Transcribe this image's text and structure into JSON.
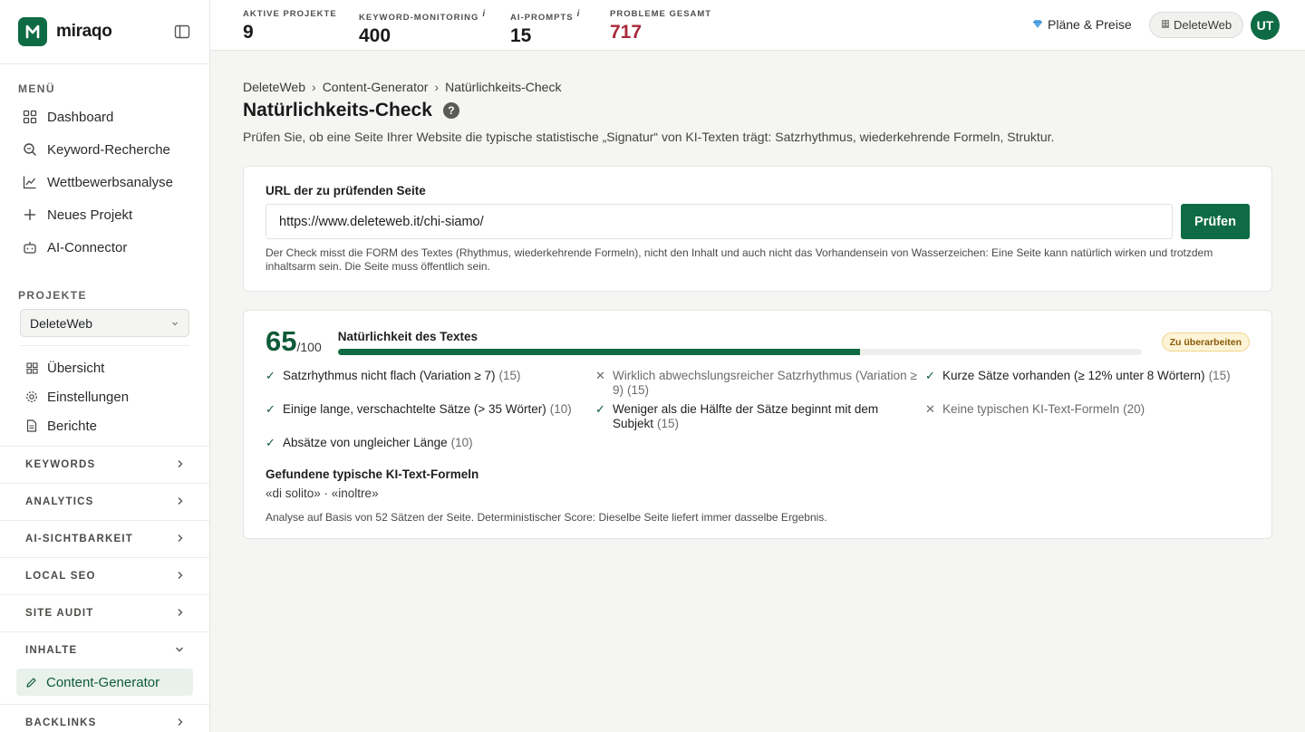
{
  "brand": {
    "name": "miraqo"
  },
  "sidebar": {
    "menu_label": "MENÜ",
    "menu_items": [
      {
        "label": "Dashboard",
        "icon": "grid-icon"
      },
      {
        "label": "Keyword-Recherche",
        "icon": "search-icon"
      },
      {
        "label": "Wettbewerbsanalyse",
        "icon": "chart-icon"
      },
      {
        "label": "Neues Projekt",
        "icon": "plus-icon"
      },
      {
        "label": "AI-Connector",
        "icon": "bot-icon"
      }
    ],
    "projects_label": "PROJEKTE",
    "project_selected": "DeleteWeb",
    "project_items": [
      {
        "label": "Übersicht",
        "icon": "grid-icon"
      },
      {
        "label": "Einstellungen",
        "icon": "gear-icon"
      },
      {
        "label": "Berichte",
        "icon": "document-icon"
      }
    ],
    "groups": [
      "KEYWORDS",
      "ANALYTICS",
      "AI-SICHTBARKEIT",
      "LOCAL SEO",
      "SITE AUDIT",
      "INHALTE"
    ],
    "active_item": "Content-Generator",
    "last_group": "BACKLINKS"
  },
  "topbar": {
    "stats": [
      {
        "label": "AKTIVE PROJEKTE",
        "value": "9",
        "info": ""
      },
      {
        "label": "KEYWORD-MONITORING",
        "value": "400",
        "info": "i"
      },
      {
        "label": "AI-PROMPTS",
        "value": "15",
        "info": "i"
      },
      {
        "label": "PROBLEME GESAMT",
        "value": "717",
        "info": ""
      }
    ],
    "plans_label": "Pläne & Preise",
    "project_pill": "DeleteWeb",
    "avatar_initials": "UT"
  },
  "breadcrumb": [
    "DeleteWeb",
    "Content-Generator",
    "Natürlichkeits-Check"
  ],
  "page": {
    "title": "Natürlichkeits-Check",
    "help": "?",
    "subtitle": "Prüfen Sie, ob eine Seite Ihrer Website die typische statistische „Signatur“ von KI-Texten trägt: Satzrhythmus, wiederkehrende Formeln, Struktur."
  },
  "url_form": {
    "label": "URL der zu prüfenden Seite",
    "value": "https://www.deleteweb.it/chi-siamo/",
    "button": "Prüfen",
    "hint": "Der Check misst die FORM des Textes (Rhythmus, wiederkehrende Formeln), nicht den Inhalt und auch nicht das Vorhandensein von Wasserzeichen: Eine Seite kann natürlich wirken und trotzdem inhaltsarm sein. Die Seite muss öffentlich sein."
  },
  "result": {
    "score": "65",
    "score_max": "/100",
    "score_fraction": 0.65,
    "bar_title": "Natürlichkeit des Textes",
    "badge": "Zu überarbeiten",
    "criteria": [
      {
        "ok": true,
        "text": "Satzrhythmus nicht flach (Variation ≥ 7)",
        "points": "(15)"
      },
      {
        "ok": false,
        "text": "Wirklich abwechslungsreicher Satzrhythmus (Variation ≥ 9)",
        "points": "(15)"
      },
      {
        "ok": true,
        "text": "Kurze Sätze vorhanden (≥ 12% unter 8 Wörtern)",
        "points": "(15)"
      },
      {
        "ok": true,
        "text": "Einige lange, verschachtelte Sätze (> 35 Wörter)",
        "points": "(10)"
      },
      {
        "ok": true,
        "text": "Weniger als die Hälfte der Sätze beginnt mit dem Subjekt",
        "points": "(15)"
      },
      {
        "ok": false,
        "text": "Keine typischen KI-Text-Formeln",
        "points": "(20)"
      },
      {
        "ok": true,
        "text": "Absätze von ungleicher Länge",
        "points": "(10)"
      }
    ],
    "formulas_title": "Gefundene typische KI-Text-Formeln",
    "formulas": "«di solito» · «inoltre»",
    "footnote": "Analyse auf Basis von 52 Sätzen der Seite. Deterministischer Score: Dieselbe Seite liefert immer dasselbe Ergebnis."
  },
  "colors": {
    "brand": "#0e6b43",
    "danger": "#a8283a",
    "badge_bg": "#fdf3d6"
  }
}
